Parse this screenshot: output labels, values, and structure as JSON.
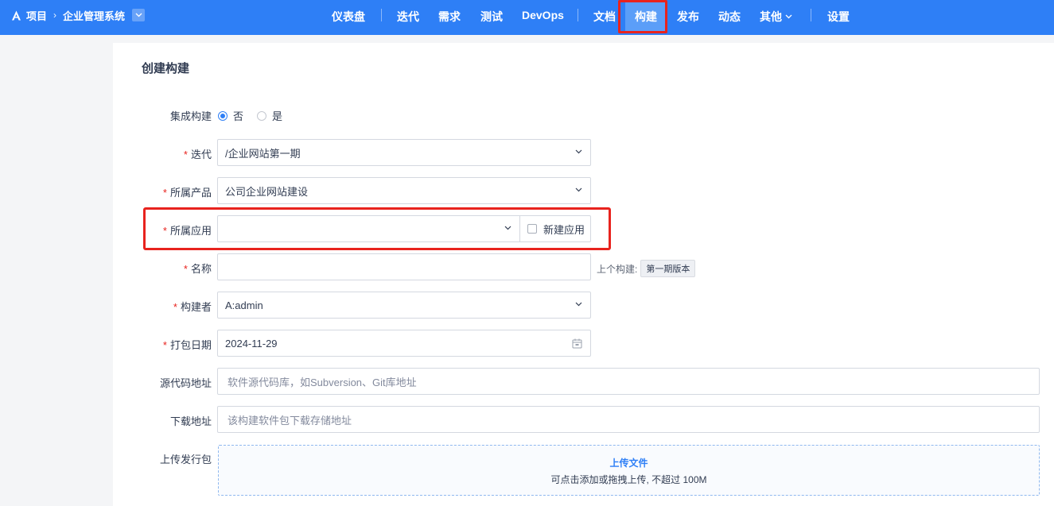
{
  "header": {
    "project_label": "项目",
    "system_name": "企业管理系统",
    "nav": [
      "仪表盘",
      "迭代",
      "需求",
      "测试",
      "DevOps",
      "文档",
      "构建",
      "发布",
      "动态",
      "其他",
      "设置"
    ],
    "active_nav": "构建"
  },
  "page": {
    "title": "创建构建"
  },
  "form": {
    "integrated": {
      "label": "集成构建",
      "options": [
        "否",
        "是"
      ],
      "selected": "否"
    },
    "iteration": {
      "label": "迭代",
      "value": "/企业网站第一期"
    },
    "product": {
      "label": "所属产品",
      "value": "公司企业网站建设"
    },
    "app": {
      "label": "所属应用",
      "value": "",
      "new_app_label": "新建应用"
    },
    "name": {
      "label": "名称",
      "value": "",
      "prev_build_label": "上个构建:",
      "prev_build_tag": "第一期版本"
    },
    "builder": {
      "label": "构建者",
      "value": "A:admin"
    },
    "date": {
      "label": "打包日期",
      "value": "2024-11-29"
    },
    "source": {
      "label": "源代码地址",
      "placeholder": "软件源代码库，如Subversion、Git库地址"
    },
    "download": {
      "label": "下载地址",
      "placeholder": "该构建软件包下载存储地址"
    },
    "upload": {
      "label": "上传发行包",
      "title": "上传文件",
      "desc": "可点击添加或拖拽上传, 不超过 100M"
    }
  },
  "colors": {
    "primary": "#2e7ff6",
    "highlight": "#e8231e"
  }
}
